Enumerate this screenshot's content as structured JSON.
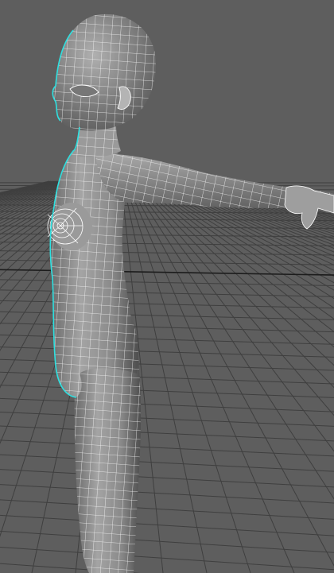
{
  "viewport": {
    "view": "perspective",
    "background_color": "#5e5e5e",
    "grid_color": "#3f3f3f",
    "grid_axis_color": "#1c1c1c",
    "mesh_fill_color": "#8c8c8c",
    "wireframe_color": "#ffffff",
    "selection_highlight_color": "#2ee0e0",
    "model": {
      "icon": "character-mesh-icon",
      "display": "smooth-shaded-with-wireframe",
      "selected": true
    }
  }
}
